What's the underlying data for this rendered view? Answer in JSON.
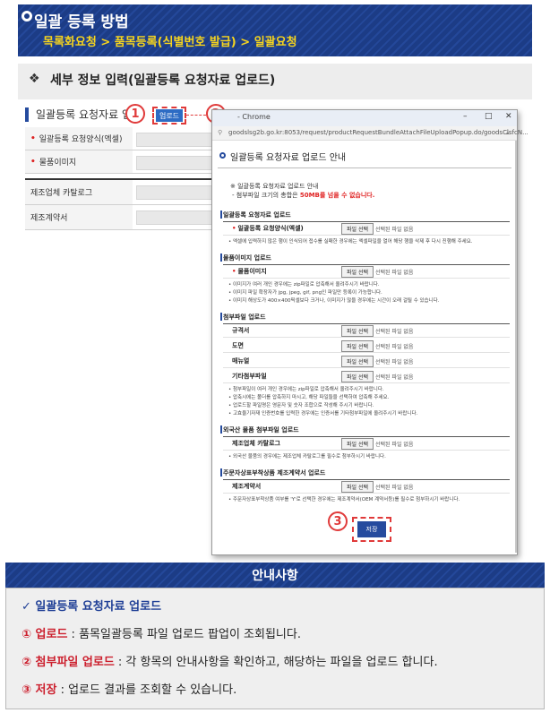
{
  "header": {
    "title": "일괄 등록 방법",
    "breadcrumb": "목록화요청 > 품목등록(식별번호 발급) > 일괄요청"
  },
  "section": {
    "title": "세부 정보 입력(일괄등록 요청자료 업로드)"
  },
  "background_form": {
    "heading": "일괄등록 요청자료 업",
    "upload_button": "업로드",
    "rows": [
      {
        "label": "일괄등록 요청양식(엑셀)",
        "required": true
      },
      {
        "label": "물품이미지",
        "required": true
      },
      {
        "label": "제조업체 카탈로그",
        "required": false
      },
      {
        "label": "제조계약서",
        "required": false
      }
    ]
  },
  "markers": [
    "1",
    "2",
    "3"
  ],
  "popup": {
    "window_title": "- Chrome",
    "url": "goodslsg2b.go.kr:8053/request/productRequestBundleAttachFileUploadPopup.do/goodsClsfcN...",
    "heading": "일괄등록 요청자료 업로드 안내",
    "notice_line1": "※ 일괄등록 요청자료 업로드 안내",
    "notice_line2_pre": "- 첨부파일 크기의 총합은 ",
    "notice_line2_hl": "50MB를 넘을 수 없습니다.",
    "file_button": "파일 선택",
    "no_file": "선택된 파일 없음",
    "save_button": "저장",
    "sections": {
      "s1": {
        "title": "일괄등록 요청자료 업로드",
        "field": "일괄등록 요청양식(엑셀)",
        "bullet": "• 엑셀에 입력하지 않은 행이 인식되어 접수를 실패한 경우에는 엑셀파일을 열어 해당 행을 삭제 후 다시 진행해 주세요."
      },
      "s2": {
        "title": "물품이미지 업로드",
        "field": "물품이미지",
        "bullets": [
          "• 이미지가 여러 개인 경우에는 zip파일로 압축해서 올려주시기 바랍니다.",
          "• 이미지 파일 확장자가 jpg, jpeg, gif, png인 파일만 등록이 가능합니다.",
          "• 이미지 해상도가 400×400픽셀보다 크거나, 이미지가 많을 경우에는 시간이 오래 걸릴 수 있습니다."
        ]
      },
      "s3": {
        "title": "첨부파일 업로드",
        "fields": [
          "규격서",
          "도면",
          "매뉴얼",
          "기타첨부파일"
        ],
        "bullets": [
          "• 첨부파일이 여러 개인 경우에는 zip파일로 압축해서 올려주시기 바랍니다.",
          "• 압축시에는 폴더를 압축하지 마시고, 해당 파일들을 선택하여 압축해 주세요.",
          "• 업로드할 파일명은 영문자 및 숫자 조합으로 작성해 주시기 바랍니다.",
          "• 고효율기자재 인증번호를 입력한 경우에는 인증서를 기타첨부파일에 올려주시기 바랍니다."
        ]
      },
      "s4": {
        "title": "외국산 물품 첨부파일 업로드",
        "field": "제조업체 카탈로그",
        "bullet": "• 외국산 물품의 경우에는 제조업체 카탈로그를 필수로 첨부하시기 바랍니다."
      },
      "s5": {
        "title": "주문자상표부착상품 제조계약서 업로드",
        "field": "제조계약서",
        "bullet": "• 주문자상표부착상품 여부를 'Y'로 선택한 경우에는 제조계약서(OEM 계약서등)를 필수로 첨부하시기 바랍니다."
      }
    }
  },
  "notice": {
    "title": "안내사항",
    "heading": "✓ 일괄등록 요청자료 업로드",
    "items": [
      {
        "key": "① 업로드",
        "desc": " : 품목일괄등록 파일 업로드 팝업이 조회됩니다."
      },
      {
        "key": "② 첨부파일 업로드",
        "desc": " : 각 항목의 안내사항을 확인하고, 해당하는 파일을 업로드 합니다."
      },
      {
        "key": "③ 저장",
        "desc": " : 업로드 결과를 조회할 수 있습니다."
      }
    ]
  },
  "colors": {
    "navy": "#1c3c86",
    "accent_red": "#e03a3a",
    "highlight_yellow": "#f7d51d",
    "notice_red": "#cc1f2d"
  }
}
